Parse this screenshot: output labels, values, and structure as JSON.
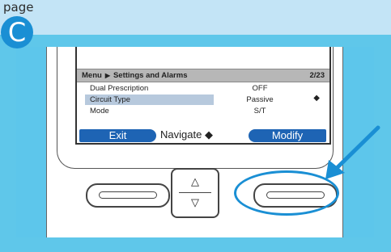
{
  "page": {
    "label": "page",
    "step_badge": "C"
  },
  "screen": {
    "menu": {
      "root": "Menu",
      "arrow_icon": "right-triangle-icon",
      "title": "Settings and Alarms",
      "page_indicator": "2/23"
    },
    "rows": [
      {
        "label": "Dual Prescription",
        "value": "OFF",
        "selected": false
      },
      {
        "label": "Circuit Type",
        "value": "Passive",
        "selected": true
      },
      {
        "label": "Mode",
        "value": "S/T",
        "selected": false
      }
    ],
    "softkeys": {
      "left": "Exit",
      "center": "Navigate",
      "center_icon": "up-down-arrows-icon",
      "right": "Modify"
    }
  },
  "hardware": {
    "nav_up": "△",
    "nav_down": "▽"
  },
  "colors": {
    "accent": "#1a8fd4",
    "softkey": "#1e64b4",
    "panel": "#5fc7ea",
    "header_band": "#c3e4f6"
  }
}
